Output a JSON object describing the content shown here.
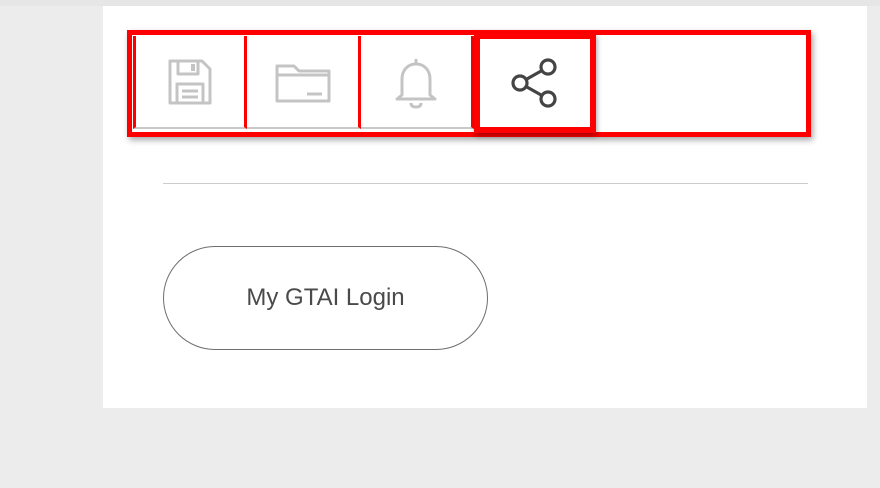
{
  "toolbar": {
    "items": [
      {
        "icon": "save-icon",
        "state": "inactive"
      },
      {
        "icon": "folder-icon",
        "state": "inactive"
      },
      {
        "icon": "bell-icon",
        "state": "inactive"
      },
      {
        "icon": "share-icon",
        "state": "active"
      }
    ],
    "colors": {
      "highlight": "#ff0000",
      "icon_inactive": "#c4c4c4",
      "icon_active": "#444444"
    }
  },
  "login": {
    "label": "My GTAI Login"
  }
}
